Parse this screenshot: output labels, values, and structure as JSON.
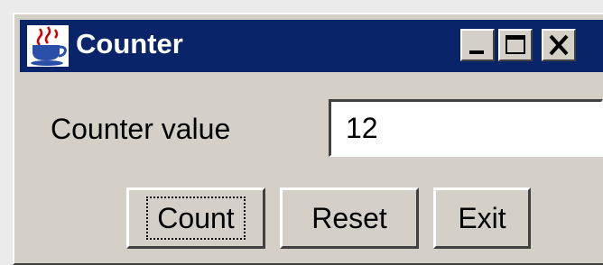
{
  "window": {
    "title": "Counter",
    "titlebar_color": "#0a246a",
    "controls": {
      "minimize_icon": "minimize-icon",
      "maximize_icon": "maximize-icon",
      "close_icon": "close-icon"
    },
    "app_icon": "java-cup-icon"
  },
  "form": {
    "label": "Counter value",
    "value": "12"
  },
  "buttons": {
    "count": "Count",
    "reset": "Reset",
    "exit": "Exit"
  }
}
